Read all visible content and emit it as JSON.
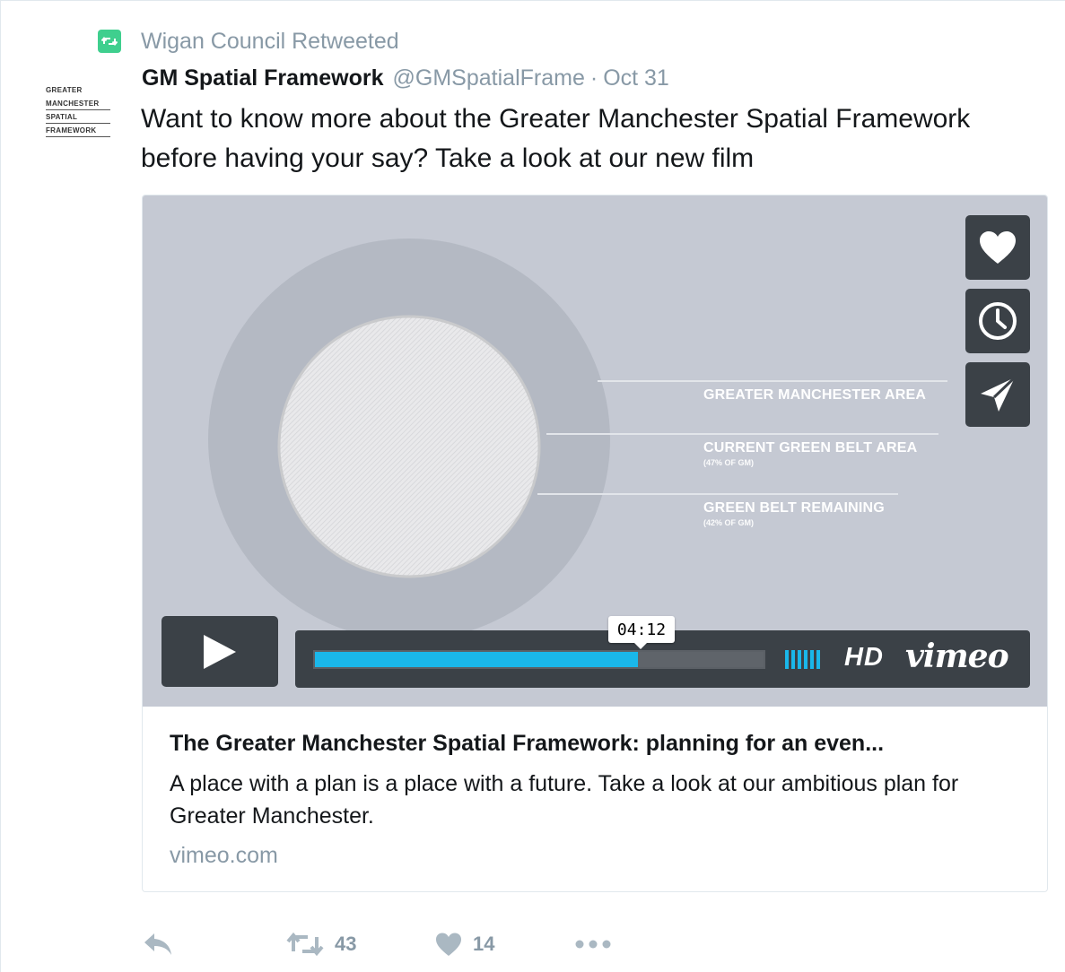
{
  "retweet_context": {
    "text": "Wigan Council Retweeted",
    "icon": "retweet-icon",
    "badge_color": "#3fcf8e"
  },
  "author": {
    "avatar_lines": [
      "GREATER",
      "MANCHESTER",
      "SPATIAL",
      "FRAMEWORK"
    ],
    "display_name": "GM Spatial Framework",
    "handle": "@GMSpatialFrame",
    "separator": "·",
    "date": "Oct 31"
  },
  "tweet_text": "Want to know more about the Greater Manchester Spatial Framework before having your say? Take a look at our new film",
  "video": {
    "labels": {
      "area": "GREATER MANCHESTER AREA",
      "current": "CURRENT GREEN BELT AREA",
      "current_sub": "(47% OF GM)",
      "remaining": "GREEN BELT REMAINING",
      "remaining_sub": "(42% OF GM)"
    },
    "side_buttons": [
      "heart-icon",
      "clock-icon",
      "send-icon"
    ],
    "time_tooltip": "04:12",
    "progress": 0.72,
    "hd_label": "HD",
    "brand": "vimeo",
    "accent_color": "#1ab7ea"
  },
  "card": {
    "title": "The Greater Manchester Spatial Framework: planning for an even...",
    "description": "A place with a plan is a place with a future. Take a look at our ambitious plan for Greater Manchester.",
    "domain": "vimeo.com"
  },
  "actions": {
    "reply_icon": "reply-icon",
    "retweet_count": "43",
    "like_count": "14",
    "more_icon": "more-icon"
  }
}
